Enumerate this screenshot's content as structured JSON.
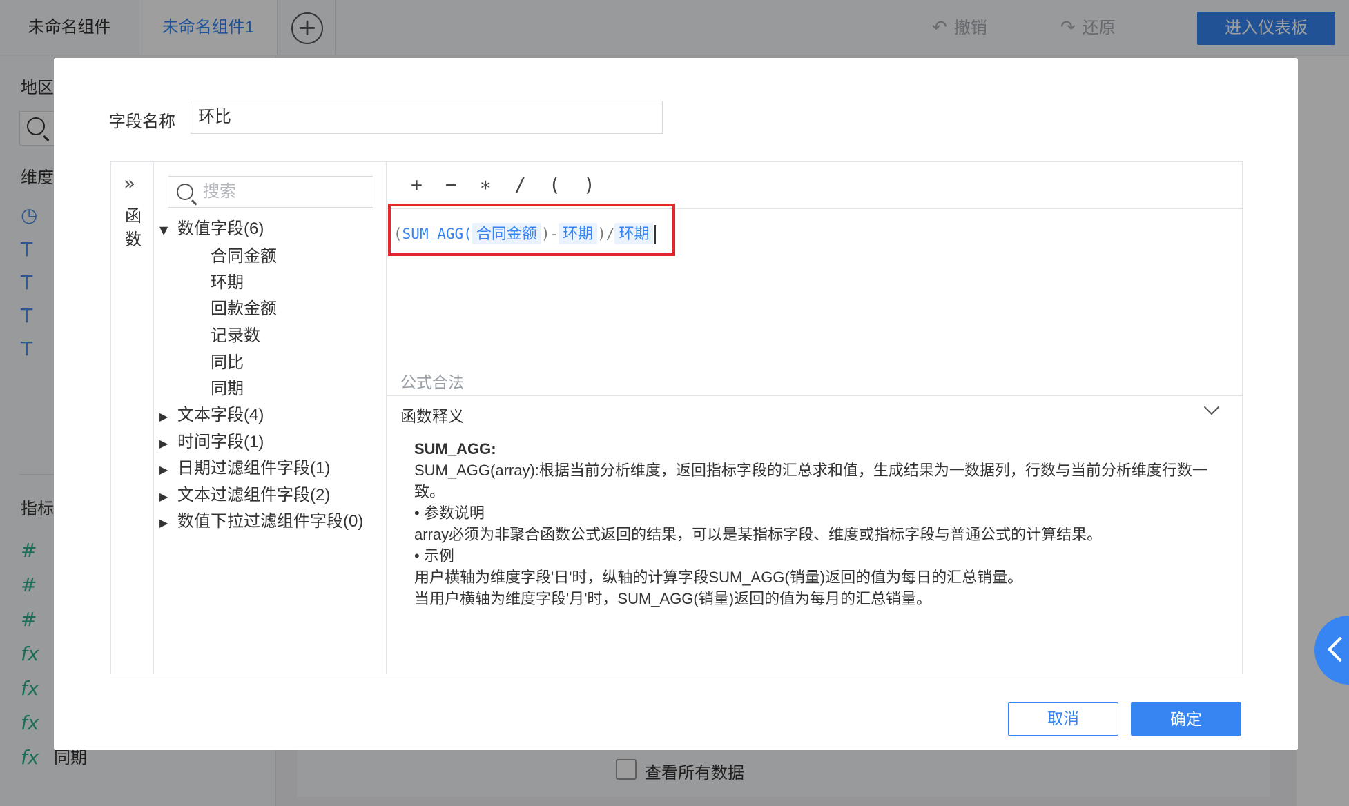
{
  "topbar": {
    "tabs": [
      {
        "label": "未命名组件"
      },
      {
        "label": "未命名组件1"
      }
    ],
    "undo_label": "撤销",
    "redo_label": "还原",
    "enter_dashboard_label": "进入仪表板"
  },
  "left_panel": {
    "region_label": "地区",
    "dimension_label": "维度",
    "metric_label": "指标",
    "last_item_label": "同期"
  },
  "bottom": {
    "view_all_label": "查看所有数据"
  },
  "dialog": {
    "field_name_label": "字段名称",
    "field_name_value": "环比",
    "function_label": "函数",
    "search_placeholder": "搜索",
    "groups": [
      {
        "label": "数值字段(6)",
        "expanded": true,
        "items": [
          "合同金额",
          "环期",
          "回款金额",
          "记录数",
          "同比",
          "同期"
        ]
      },
      {
        "label": "文本字段(4)",
        "expanded": false
      },
      {
        "label": "时间字段(1)",
        "expanded": false
      },
      {
        "label": "日期过滤组件字段(1)",
        "expanded": false
      },
      {
        "label": "文本过滤组件字段(2)",
        "expanded": false
      },
      {
        "label": "数值下拉过滤组件字段(0)",
        "expanded": false
      }
    ],
    "operators": [
      "+",
      "−",
      "∗",
      "/",
      "(",
      ")"
    ],
    "formula": {
      "open_paren": "(",
      "func": "SUM_AGG(",
      "field1": "合同金额",
      "close_minus": ")-",
      "field2": "环期",
      "close_div": ")/",
      "field3": "环期"
    },
    "validity_text": "公式合法",
    "description_title": "函数释义",
    "description": {
      "name": "SUM_AGG:",
      "line1": "SUM_AGG(array):根据当前分析维度，返回指标字段的汇总求和值，生成结果为一数据列，行数与当前分析维度行数一致。",
      "param_header": "• 参数说明",
      "param_text": "array必须为非聚合函数公式返回的结果，可以是某指标字段、维度或指标字段与普通公式的计算结果。",
      "example_header": "• 示例",
      "example1": "用户横轴为维度字段'日'时，纵轴的计算字段SUM_AGG(销量)返回的值为每日的汇总销量。",
      "example2": "当用户横轴为维度字段'月'时，SUM_AGG(销量)返回的值为每月的汇总销量。"
    },
    "cancel_label": "取消",
    "confirm_label": "确定"
  },
  "colors": {
    "accent": "#3685f2",
    "highlight_border": "#e5262b"
  }
}
